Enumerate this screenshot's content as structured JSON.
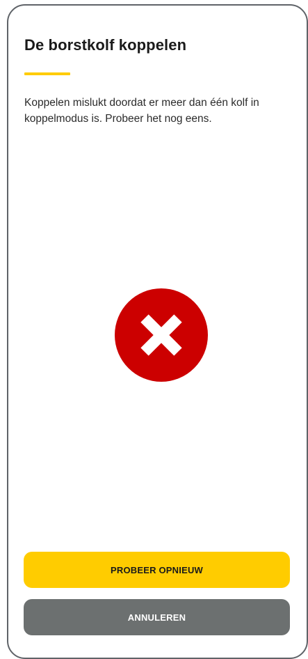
{
  "screen": {
    "title": "De borstkolf koppelen",
    "message": "Koppelen mislukt doordat er meer dan één kolf in koppelmodus is. Probeer het nog eens.",
    "status_icon": "error-x-circle-icon"
  },
  "actions": {
    "retry_label": "PROBEER OPNIEUW",
    "cancel_label": "ANNULEREN"
  },
  "colors": {
    "accent": "#ffcc00",
    "error": "#cc0000",
    "secondary_button": "#6c7070",
    "frame_border": "#5f6368"
  }
}
